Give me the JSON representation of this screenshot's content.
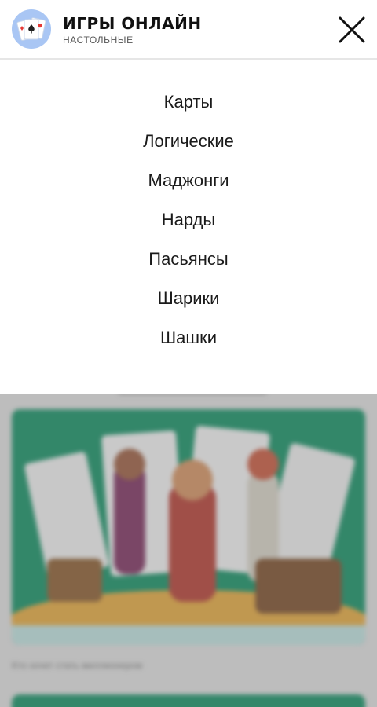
{
  "header": {
    "title": "ИГРЫ ОНЛАЙН",
    "subtitle": "НАСТОЛЬНЫЕ",
    "logo_icon": "playing-cards-icon",
    "close_icon": "close-icon"
  },
  "menu": {
    "items": [
      {
        "label": "Карты"
      },
      {
        "label": "Логические"
      },
      {
        "label": "Маджонги"
      },
      {
        "label": "Нарды"
      },
      {
        "label": "Пасьянсы"
      },
      {
        "label": "Шарики"
      },
      {
        "label": "Шашки"
      }
    ]
  },
  "background": {
    "caption": "Кто хочет стать миллионером"
  },
  "colors": {
    "accent_green": "#0f8f62",
    "logo_bg": "#a9c6f4"
  }
}
